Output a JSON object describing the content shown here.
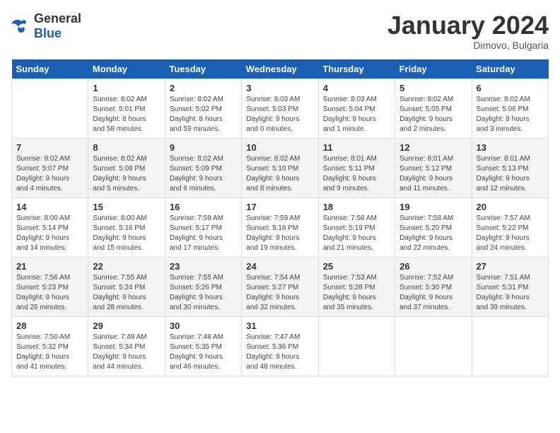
{
  "header": {
    "logo_general": "General",
    "logo_blue": "Blue",
    "month_year": "January 2024",
    "location": "Dimovo, Bulgaria"
  },
  "days_of_week": [
    "Sunday",
    "Monday",
    "Tuesday",
    "Wednesday",
    "Thursday",
    "Friday",
    "Saturday"
  ],
  "weeks": [
    [
      {
        "day": "",
        "info": ""
      },
      {
        "day": "1",
        "info": "Sunrise: 8:02 AM\nSunset: 5:01 PM\nDaylight: 8 hours\nand 58 minutes."
      },
      {
        "day": "2",
        "info": "Sunrise: 8:02 AM\nSunset: 5:02 PM\nDaylight: 8 hours\nand 59 minutes."
      },
      {
        "day": "3",
        "info": "Sunrise: 8:03 AM\nSunset: 5:03 PM\nDaylight: 9 hours\nand 0 minutes."
      },
      {
        "day": "4",
        "info": "Sunrise: 8:03 AM\nSunset: 5:04 PM\nDaylight: 9 hours\nand 1 minute."
      },
      {
        "day": "5",
        "info": "Sunrise: 8:02 AM\nSunset: 5:05 PM\nDaylight: 9 hours\nand 2 minutes."
      },
      {
        "day": "6",
        "info": "Sunrise: 8:02 AM\nSunset: 5:06 PM\nDaylight: 9 hours\nand 3 minutes."
      }
    ],
    [
      {
        "day": "7",
        "info": "Sunrise: 8:02 AM\nSunset: 5:07 PM\nDaylight: 9 hours\nand 4 minutes."
      },
      {
        "day": "8",
        "info": "Sunrise: 8:02 AM\nSunset: 5:08 PM\nDaylight: 9 hours\nand 5 minutes."
      },
      {
        "day": "9",
        "info": "Sunrise: 8:02 AM\nSunset: 5:09 PM\nDaylight: 9 hours\nand 6 minutes."
      },
      {
        "day": "10",
        "info": "Sunrise: 8:02 AM\nSunset: 5:10 PM\nDaylight: 9 hours\nand 8 minutes."
      },
      {
        "day": "11",
        "info": "Sunrise: 8:01 AM\nSunset: 5:11 PM\nDaylight: 9 hours\nand 9 minutes."
      },
      {
        "day": "12",
        "info": "Sunrise: 8:01 AM\nSunset: 5:12 PM\nDaylight: 9 hours\nand 11 minutes."
      },
      {
        "day": "13",
        "info": "Sunrise: 8:01 AM\nSunset: 5:13 PM\nDaylight: 9 hours\nand 12 minutes."
      }
    ],
    [
      {
        "day": "14",
        "info": "Sunrise: 8:00 AM\nSunset: 5:14 PM\nDaylight: 9 hours\nand 14 minutes."
      },
      {
        "day": "15",
        "info": "Sunrise: 8:00 AM\nSunset: 5:16 PM\nDaylight: 9 hours\nand 15 minutes."
      },
      {
        "day": "16",
        "info": "Sunrise: 7:59 AM\nSunset: 5:17 PM\nDaylight: 9 hours\nand 17 minutes."
      },
      {
        "day": "17",
        "info": "Sunrise: 7:59 AM\nSunset: 5:18 PM\nDaylight: 9 hours\nand 19 minutes."
      },
      {
        "day": "18",
        "info": "Sunrise: 7:58 AM\nSunset: 5:19 PM\nDaylight: 9 hours\nand 21 minutes."
      },
      {
        "day": "19",
        "info": "Sunrise: 7:58 AM\nSunset: 5:20 PM\nDaylight: 9 hours\nand 22 minutes."
      },
      {
        "day": "20",
        "info": "Sunrise: 7:57 AM\nSunset: 5:22 PM\nDaylight: 9 hours\nand 24 minutes."
      }
    ],
    [
      {
        "day": "21",
        "info": "Sunrise: 7:56 AM\nSunset: 5:23 PM\nDaylight: 9 hours\nand 26 minutes."
      },
      {
        "day": "22",
        "info": "Sunrise: 7:55 AM\nSunset: 5:24 PM\nDaylight: 9 hours\nand 28 minutes."
      },
      {
        "day": "23",
        "info": "Sunrise: 7:55 AM\nSunset: 5:26 PM\nDaylight: 9 hours\nand 30 minutes."
      },
      {
        "day": "24",
        "info": "Sunrise: 7:54 AM\nSunset: 5:27 PM\nDaylight: 9 hours\nand 32 minutes."
      },
      {
        "day": "25",
        "info": "Sunrise: 7:53 AM\nSunset: 5:28 PM\nDaylight: 9 hours\nand 35 minutes."
      },
      {
        "day": "26",
        "info": "Sunrise: 7:52 AM\nSunset: 5:30 PM\nDaylight: 9 hours\nand 37 minutes."
      },
      {
        "day": "27",
        "info": "Sunrise: 7:51 AM\nSunset: 5:31 PM\nDaylight: 9 hours\nand 39 minutes."
      }
    ],
    [
      {
        "day": "28",
        "info": "Sunrise: 7:50 AM\nSunset: 5:32 PM\nDaylight: 9 hours\nand 41 minutes."
      },
      {
        "day": "29",
        "info": "Sunrise: 7:49 AM\nSunset: 5:34 PM\nDaylight: 9 hours\nand 44 minutes."
      },
      {
        "day": "30",
        "info": "Sunrise: 7:48 AM\nSunset: 5:35 PM\nDaylight: 9 hours\nand 46 minutes."
      },
      {
        "day": "31",
        "info": "Sunrise: 7:47 AM\nSunset: 5:36 PM\nDaylight: 9 hours\nand 48 minutes."
      },
      {
        "day": "",
        "info": ""
      },
      {
        "day": "",
        "info": ""
      },
      {
        "day": "",
        "info": ""
      }
    ]
  ]
}
